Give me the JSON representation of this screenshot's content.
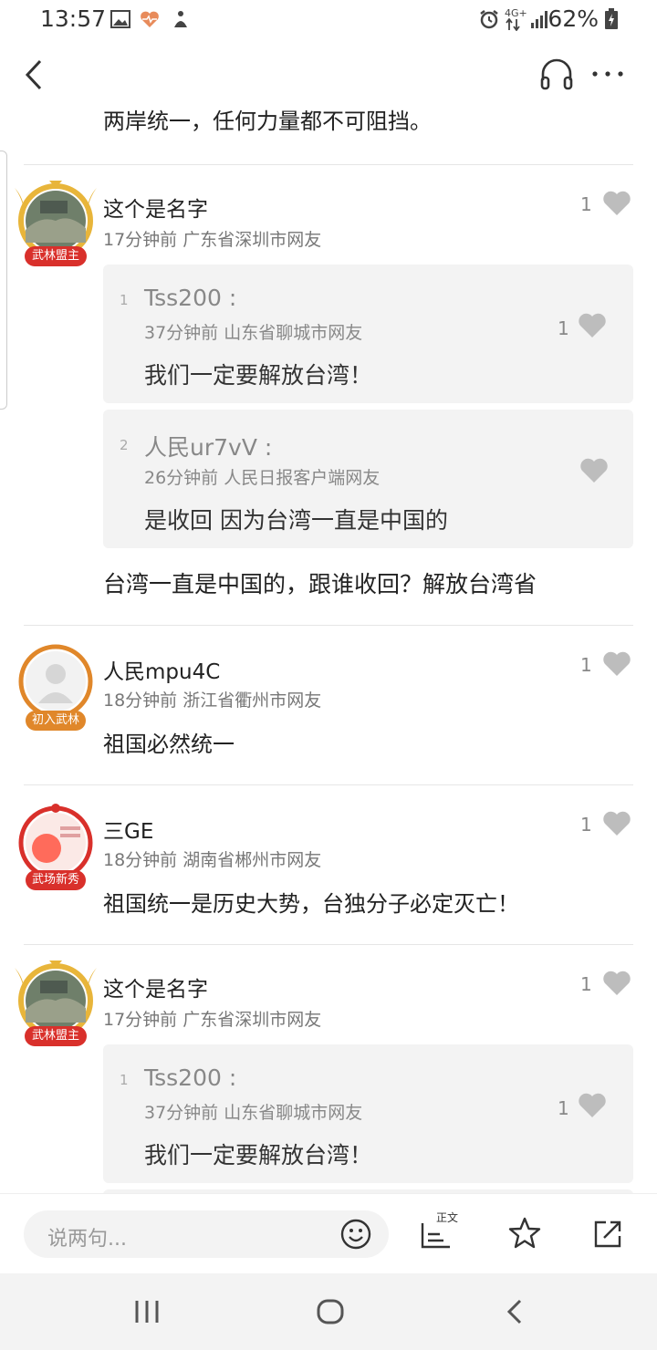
{
  "status_bar": {
    "time": "13:57",
    "battery": "62%",
    "network": "4G+"
  },
  "top_bar": {
    "back_icon": "back-chevron-icon",
    "audio_icon": "headphones-icon",
    "more_icon": "more-dots-icon"
  },
  "prev_comment_tail": "两岸统一，任何力量都不可阻挡。",
  "comments": [
    {
      "name": "这个是名字",
      "meta": "17分钟前 广东省深圳市网友",
      "likes": "1",
      "badge": "武林盟主",
      "replies": [
        {
          "index": "1",
          "name": "Tss200 :",
          "meta": "37分钟前 山东省聊城市网友",
          "likes": "1",
          "text": "我们一定要解放台湾！"
        },
        {
          "index": "2",
          "name": "人民ur7vV :",
          "meta": "26分钟前 人民日报客户端网友",
          "likes": "",
          "text": "是收回  因为台湾一直是中国的"
        }
      ],
      "text": "台湾一直是中国的，跟谁收回？解放台湾省"
    },
    {
      "name": "人民mpu4C",
      "meta": "18分钟前 浙江省衢州市网友",
      "likes": "1",
      "badge": "初入武林",
      "text": "祖国必然统一"
    },
    {
      "name": "三GE",
      "meta": "18分钟前 湖南省郴州市网友",
      "likes": "1",
      "badge": "武场新秀",
      "text": "祖国统一是历史大势，台独分子必定灭亡！"
    },
    {
      "name": "这个是名字",
      "meta": "17分钟前 广东省深圳市网友",
      "likes": "1",
      "badge": "武林盟主",
      "replies": [
        {
          "index": "1",
          "name": "Tss200 :",
          "meta": "37分钟前 山东省聊城市网友",
          "likes": "1",
          "text": "我们一定要解放台湾！"
        }
      ]
    }
  ],
  "bottom_bar": {
    "input_placeholder": "说两句...",
    "article_label": "正文"
  },
  "colors": {
    "heart": "#bdbdbd",
    "badge_red": "#d9302b",
    "badge_orange": "#e0872a",
    "gold": "#e8b53a"
  }
}
